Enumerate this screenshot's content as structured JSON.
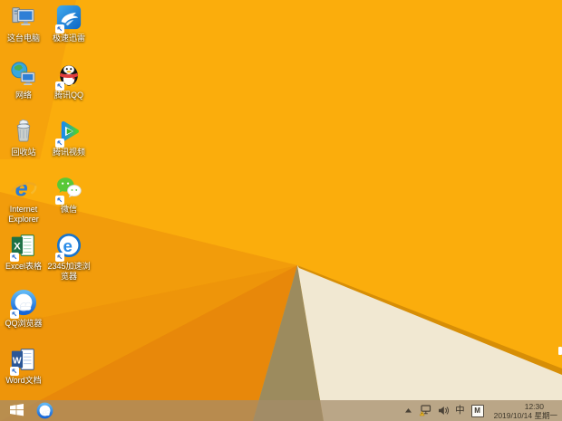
{
  "wallpaper": {
    "base": "#FBAD0C",
    "facet_topleft": "#F6A30C",
    "facet_left": "#F29C0B",
    "facet_left2": "#EE950A",
    "facet_bottom": "#E8880A",
    "facet_olive": "#9C8B5E",
    "facet_cream": "#F1E8D2",
    "ridge": "#D78E06",
    "edge_icon_sliver": "#FFFFFF"
  },
  "desktop": {
    "icons": [
      {
        "id": "this-pc",
        "label": "这台电脑",
        "col": 0,
        "row": 0,
        "shortcut": false
      },
      {
        "id": "xunlei",
        "label": "极速迅雷",
        "col": 1,
        "row": 0,
        "shortcut": true
      },
      {
        "id": "network",
        "label": "网络",
        "col": 0,
        "row": 1,
        "shortcut": false
      },
      {
        "id": "tencent-qq",
        "label": "腾讯QQ",
        "col": 1,
        "row": 1,
        "shortcut": true
      },
      {
        "id": "recycle-bin",
        "label": "回收站",
        "col": 0,
        "row": 2,
        "shortcut": false
      },
      {
        "id": "tencent-video",
        "label": "腾讯视频",
        "col": 1,
        "row": 2,
        "shortcut": true
      },
      {
        "id": "internet-explorer",
        "label": "Internet Explorer",
        "col": 0,
        "row": 3,
        "shortcut": false
      },
      {
        "id": "wechat",
        "label": "微信",
        "col": 1,
        "row": 3,
        "shortcut": true
      },
      {
        "id": "excel",
        "label": "Excel表格",
        "col": 0,
        "row": 4,
        "shortcut": true
      },
      {
        "id": "browser-2345",
        "label": "2345加速浏览器",
        "col": 1,
        "row": 4,
        "shortcut": true
      },
      {
        "id": "qq-browser",
        "label": "QQ浏览器",
        "col": 0,
        "row": 5,
        "shortcut": true
      },
      {
        "id": "word",
        "label": "Word文档",
        "col": 0,
        "row": 6,
        "shortcut": true
      }
    ]
  },
  "taskbar": {
    "bg": "rgba(165,140,105,0.72)",
    "pinned": [
      "qq-browser"
    ],
    "tray": {
      "ime_mode": "中",
      "ime_badge": "M",
      "clock_time": "12:30",
      "clock_date": "2019/10/14 星期一"
    }
  }
}
